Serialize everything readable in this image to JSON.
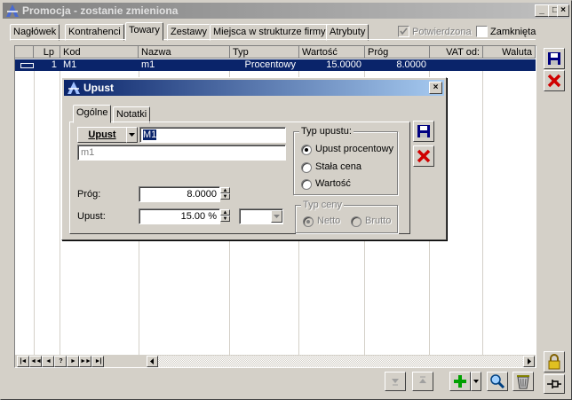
{
  "window": {
    "title": "Promocja - zostanie zmieniona",
    "min_label": "_",
    "max_label": "□",
    "close_label": "×"
  },
  "tabs": [
    "Nagłówek",
    "Kontrahenci",
    "Towary",
    "Zestawy",
    "Miejsca w strukturze firmy",
    "Atrybuty"
  ],
  "active_tab": "Towary",
  "flags": {
    "confirmed_label": "Potwierdzona",
    "confirmed": true,
    "closed_label": "Zamknięta",
    "closed": false
  },
  "grid": {
    "columns": [
      "Lp",
      "Kod",
      "Nazwa",
      "Typ",
      "Wartość",
      "Próg",
      "VAT od:",
      "Waluta"
    ],
    "rows": [
      {
        "lp": "1",
        "kod": "M1",
        "nazwa": "m1",
        "typ": "Procentowy",
        "wartosc": "15.0000",
        "prog": "8.0000",
        "vat": "",
        "waluta": ""
      }
    ]
  },
  "nav_buttons": [
    "|◄",
    "◄◄",
    "◄",
    "?",
    "►",
    "►►",
    "►|"
  ],
  "dialog": {
    "title": "Upust",
    "close_label": "×",
    "tabs": [
      "Ogólne",
      "Notatki"
    ],
    "upust_button": "Upust",
    "code_value": "M1",
    "name_value": "m1",
    "prog_label": "Próg:",
    "prog_value": "8.0000",
    "upust_label": "Upust:",
    "upust_value": "15.00",
    "upust_unit": "%",
    "typ_upustu": {
      "label": "Typ upustu:",
      "options": [
        "Upust procentowy",
        "Stała cena",
        "Wartość"
      ],
      "selected": 0
    },
    "typ_ceny": {
      "label": "Typ ceny",
      "options": [
        "Netto",
        "Brutto"
      ],
      "selected": 0
    }
  },
  "colors": {
    "selection": "#0a246a",
    "face": "#d4d0c8",
    "save_blue": "#000080",
    "delete_red": "#d00000",
    "add_green": "#00a000"
  },
  "icons": [
    "save-icon",
    "delete-icon",
    "lock-icon",
    "pin-icon",
    "add-icon",
    "search-icon",
    "trash-icon",
    "arrow-down-icon",
    "arrow-up-icon"
  ]
}
